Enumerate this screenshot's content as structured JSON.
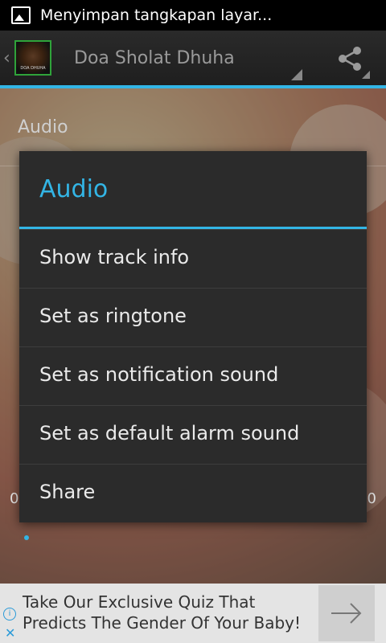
{
  "status_bar": {
    "notification_text": "Menyimpan tangkapan layar..."
  },
  "action_bar": {
    "title": "Doa Sholat Dhuha",
    "thumbnail_caption": "DOA DHUHA"
  },
  "screen": {
    "section_label": "Audio",
    "time_elapsed": "0",
    "time_total": "0"
  },
  "dialog": {
    "title": "Audio",
    "items": [
      "Show track info",
      "Set as ringtone",
      "Set as notification sound",
      "Set as default alarm sound",
      "Share"
    ]
  },
  "ad": {
    "text": "Take Our Exclusive Quiz That Predicts The Gender Of Your Baby!"
  },
  "colors": {
    "accent": "#33b5e5",
    "dialog_bg": "#2b2b2b",
    "ad_bg": "#e4e4e4"
  }
}
